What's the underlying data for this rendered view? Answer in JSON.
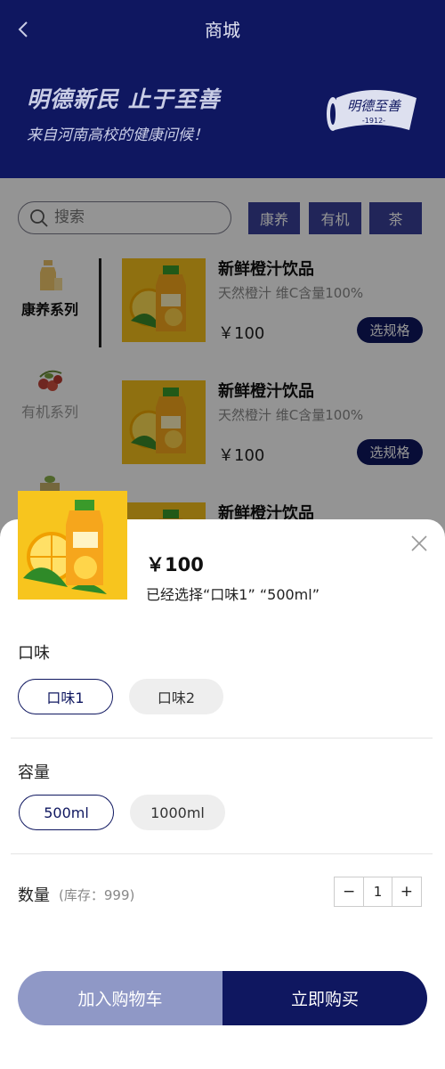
{
  "header": {
    "nav_title": "商城",
    "banner_title": "明德新民  止于至善",
    "banner_subtitle": "来自河南高校的健康问候！",
    "logo_text": "明德至善",
    "logo_year": "-1912-"
  },
  "search": {
    "placeholder": "搜索"
  },
  "filter_tags": [
    "康养",
    "有机",
    "茶"
  ],
  "categories": [
    {
      "label": "康养系列",
      "active": true
    },
    {
      "label": "有机系列",
      "active": false
    }
  ],
  "products": [
    {
      "name": "新鲜橙汁饮品",
      "desc": "天然橙汁 维C含量100%",
      "price": "￥100",
      "button": "选规格"
    },
    {
      "name": "新鲜橙汁饮品",
      "desc": "天然橙汁 维C含量100%",
      "price": "￥100",
      "button": "选规格"
    },
    {
      "name": "新鲜橙汁饮品"
    }
  ],
  "sheet": {
    "price": "￥100",
    "selected_text": "已经选择“口味1” “500ml”",
    "flavor": {
      "label": "口味",
      "options": [
        "口味1",
        "口味2"
      ],
      "selected": "口味1"
    },
    "capacity": {
      "label": "容量",
      "options": [
        "500ml",
        "1000ml"
      ],
      "selected": "500ml"
    },
    "quantity": {
      "label": "数量",
      "stock_text": "(库存：999)",
      "minus": "−",
      "value": "1",
      "plus": "+"
    },
    "add_to_cart": "加入购物车",
    "buy_now": "立即购买"
  },
  "colors": {
    "primary": "#0f1760",
    "tag": "#39409a",
    "cart_button": "#8f98c6",
    "overlay": "rgba(0,0,0,0.42)"
  }
}
